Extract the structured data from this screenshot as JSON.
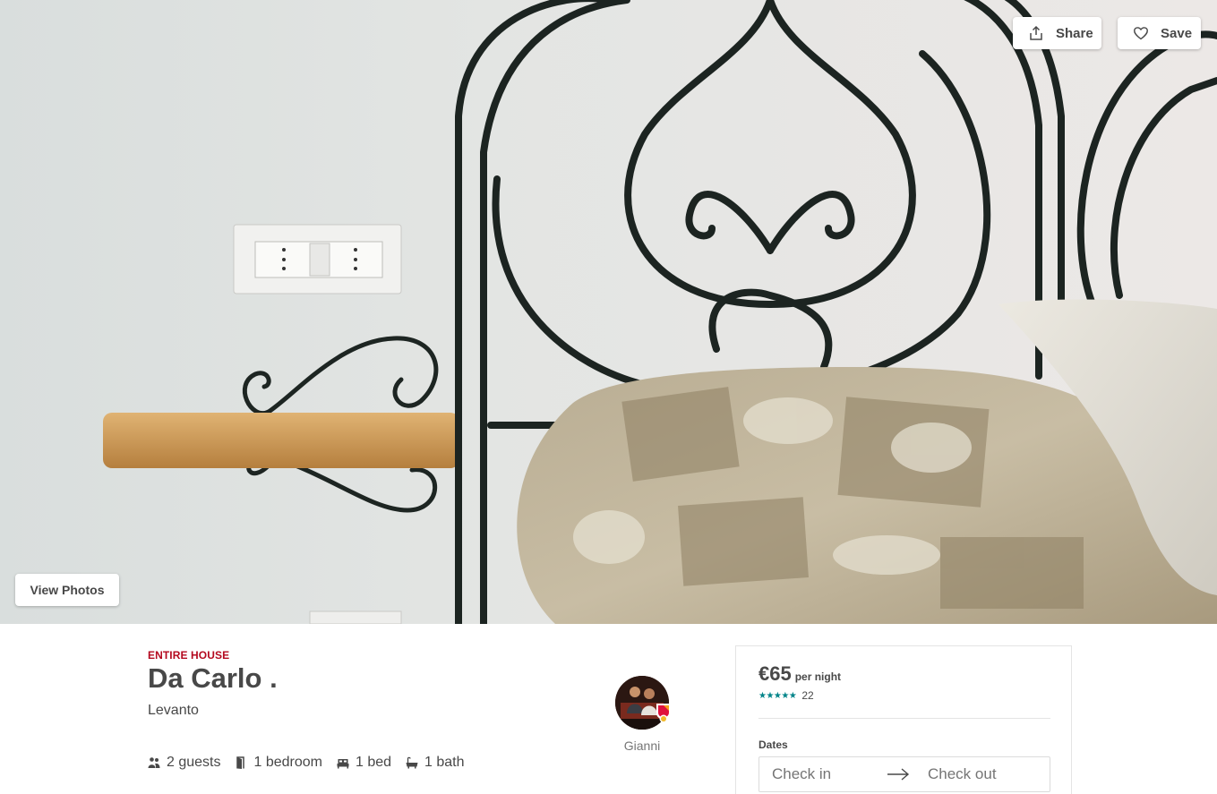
{
  "hero": {
    "share_label": "Share",
    "save_label": "Save",
    "view_photos_label": "View Photos"
  },
  "listing": {
    "kind": "ENTIRE HOUSE",
    "title": "Da Carlo .",
    "location": "Levanto",
    "amenities": [
      {
        "icon": "guests-icon",
        "label": "2 guests"
      },
      {
        "icon": "bedroom-icon",
        "label": "1 bedroom"
      },
      {
        "icon": "bed-icon",
        "label": "1 bed"
      },
      {
        "icon": "bath-icon",
        "label": "1 bath"
      }
    ]
  },
  "host": {
    "name": "Gianni"
  },
  "booking": {
    "price": "€65",
    "per": "per night",
    "stars": "★★★★★",
    "rating_value": 5,
    "review_count": "22",
    "dates_label": "Dates",
    "check_in_placeholder": "Check in",
    "check_out_placeholder": "Check out"
  },
  "colors": {
    "brand_red": "#b4091f",
    "star_teal": "#008489",
    "text": "#484848"
  }
}
